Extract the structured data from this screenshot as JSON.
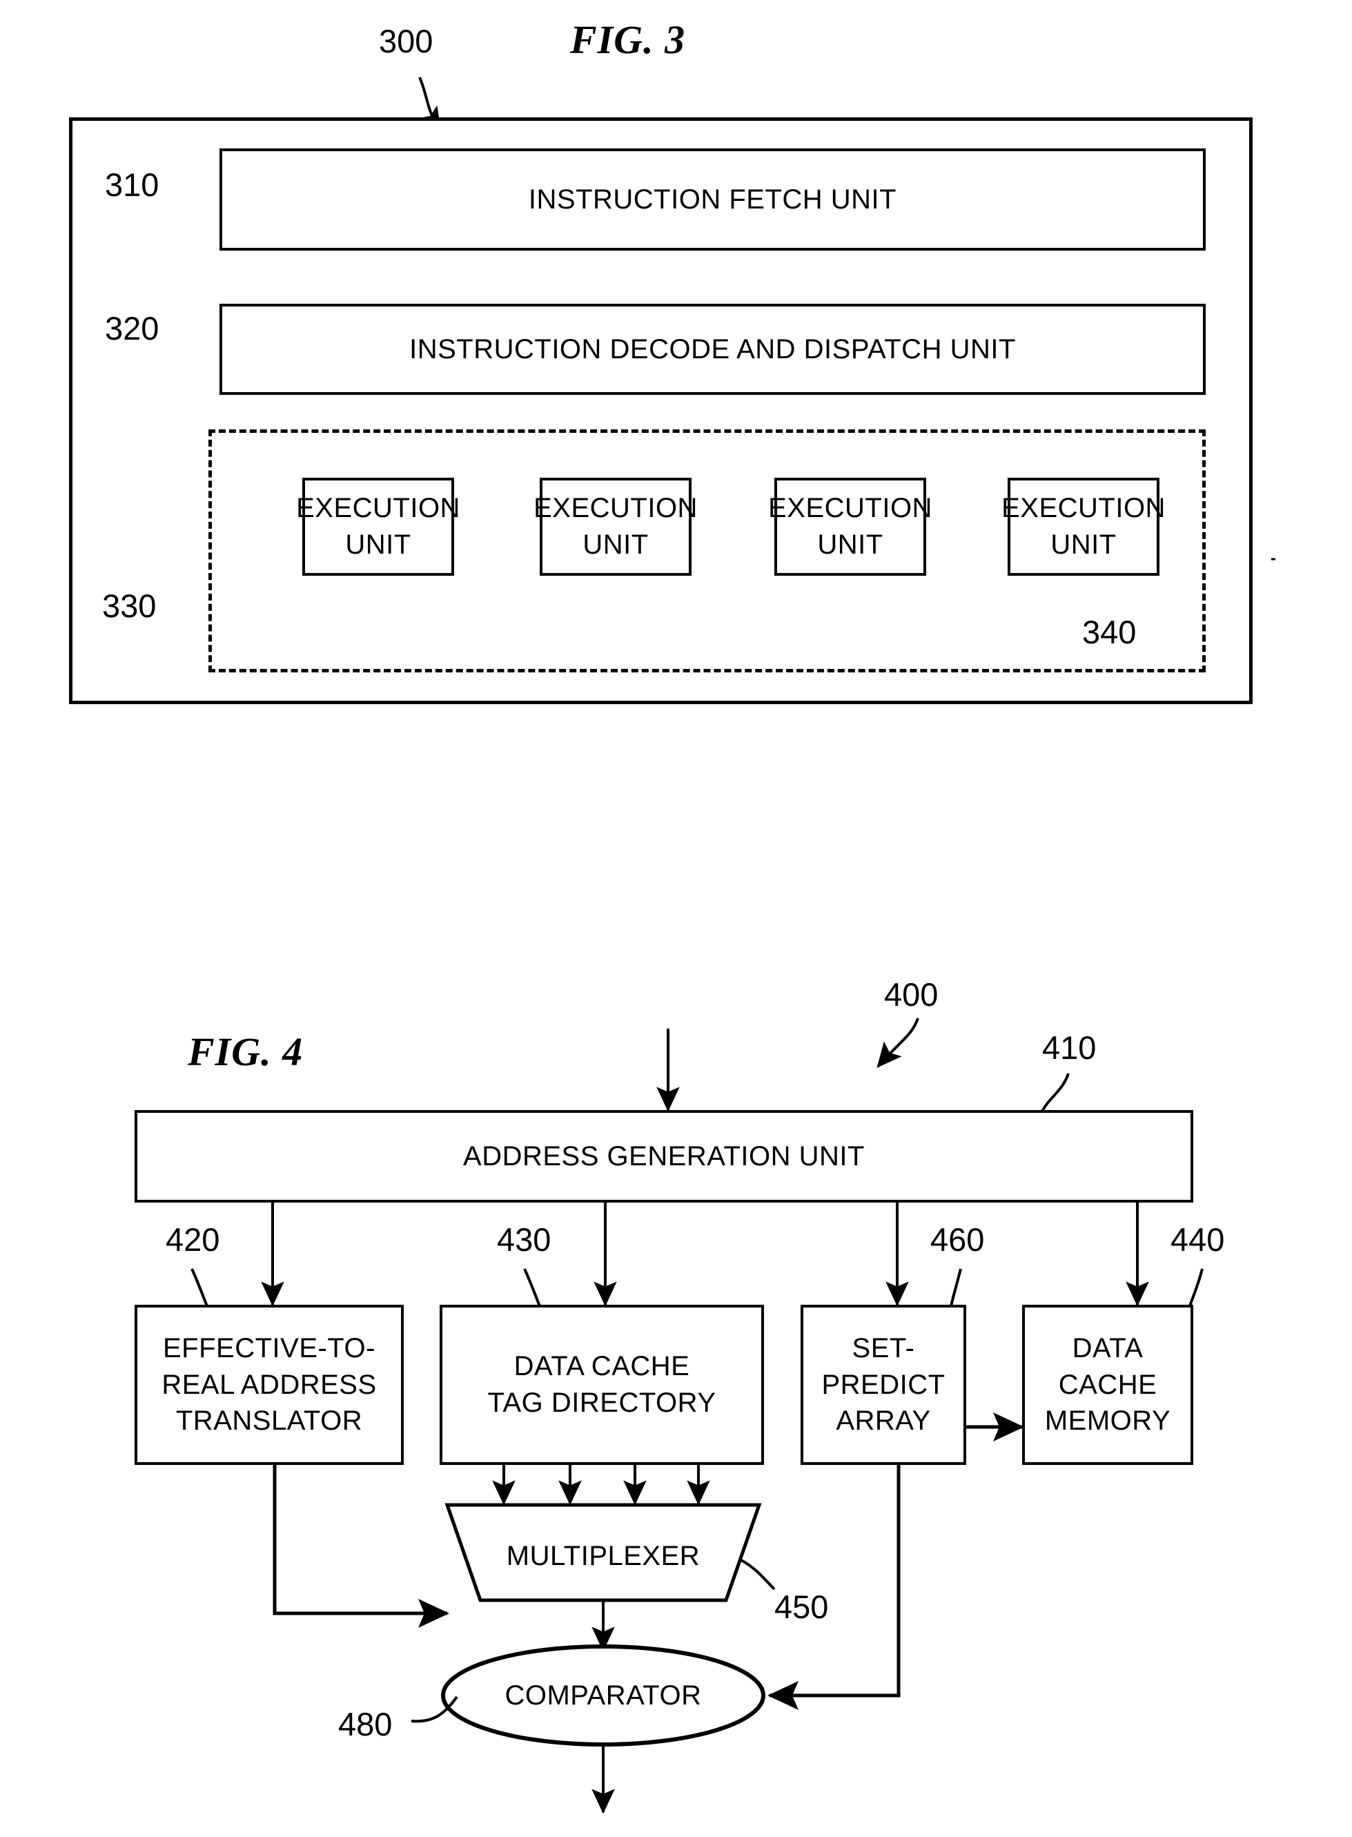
{
  "figures": [
    {
      "id": "fig3",
      "title": "FIG. 3",
      "ref": "300",
      "blocks": [
        {
          "ref": "310",
          "label": "INSTRUCTION FETCH UNIT"
        },
        {
          "ref": "320",
          "label": "INSTRUCTION DECODE AND DISPATCH UNIT"
        },
        {
          "ref": "330",
          "label": ""
        },
        {
          "ref": "340",
          "label": "EXECUTION UNIT"
        }
      ],
      "execution_units": [
        {
          "line1": "EXECUTION",
          "line2": "UNIT"
        },
        {
          "line1": "EXECUTION",
          "line2": "UNIT"
        },
        {
          "line1": "EXECUTION",
          "line2": "UNIT"
        },
        {
          "line1": "EXECUTION",
          "line2": "UNIT"
        }
      ]
    },
    {
      "id": "fig4",
      "title": "FIG. 4",
      "ref": "400",
      "blocks": [
        {
          "ref": "410",
          "label": "ADDRESS GENERATION UNIT"
        },
        {
          "ref": "420",
          "label": "EFFECTIVE-TO-\nREAL ADDRESS\nTRANSLATOR"
        },
        {
          "ref": "430",
          "label": "DATA CACHE\nTAG DIRECTORY"
        },
        {
          "ref": "460",
          "label": "SET-\nPREDICT\nARRAY"
        },
        {
          "ref": "440",
          "label": "DATA\nCACHE\nMEMORY"
        },
        {
          "ref": "450",
          "label": "MULTIPLEXER"
        },
        {
          "ref": "480",
          "label": "COMPARATOR"
        }
      ]
    }
  ],
  "fig3": {
    "title": "FIG. 3",
    "ref_300": "300",
    "ref_310": "310",
    "ref_320": "320",
    "ref_330": "330",
    "ref_340": "340",
    "fetch_unit": "INSTRUCTION FETCH UNIT",
    "decode_unit": "INSTRUCTION DECODE AND DISPATCH UNIT",
    "exec_1_line1": "EXECUTION",
    "exec_1_line2": "UNIT",
    "exec_2_line1": "EXECUTION",
    "exec_2_line2": "UNIT",
    "exec_3_line1": "EXECUTION",
    "exec_3_line2": "UNIT",
    "exec_4_line1": "EXECUTION",
    "exec_4_line2": "UNIT"
  },
  "fig4": {
    "title": "FIG. 4",
    "ref_400": "400",
    "ref_410": "410",
    "ref_420": "420",
    "ref_430": "430",
    "ref_440": "440",
    "ref_450": "450",
    "ref_460": "460",
    "ref_480": "480",
    "agu": "ADDRESS GENERATION UNIT",
    "ertat_l1": "EFFECTIVE-TO-",
    "ertat_l2": "REAL ADDRESS",
    "ertat_l3": "TRANSLATOR",
    "tagdir_l1": "DATA CACHE",
    "tagdir_l2": "TAG DIRECTORY",
    "setpred_l1": "SET-",
    "setpred_l2": "PREDICT",
    "setpred_l3": "ARRAY",
    "dcmem_l1": "DATA",
    "dcmem_l2": "CACHE",
    "dcmem_l3": "MEMORY",
    "multiplexer": "MULTIPLEXER",
    "comparator": "COMPARATOR"
  },
  "colors": {
    "ink": "#000000",
    "paper": "#ffffff"
  }
}
